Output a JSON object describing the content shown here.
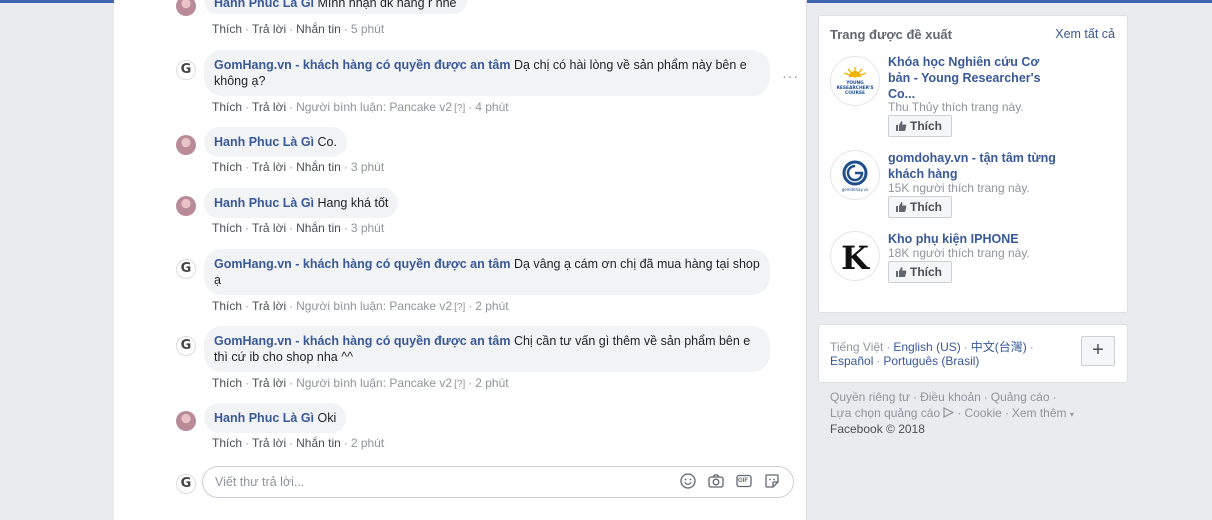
{
  "comments": [
    {
      "author": "Hanh Phuc Là Gì",
      "text": "Mình nhận đk hàng r nhé",
      "actions": [
        "Thích",
        "Trả lời",
        "Nhắn tin"
      ],
      "time": "5 phút",
      "avatar": "photo"
    },
    {
      "author": "GomHang.vn - khách hàng có quyền được an tâm",
      "text": "Dạ chị có hài lòng về sản phẩm này bên e không ạ?",
      "actions": [
        "Thích",
        "Trả lời"
      ],
      "plugin": "Người bình luận: Pancake v2",
      "help": "[?]",
      "time": "4 phút",
      "avatar": "G"
    },
    {
      "author": "Hanh Phuc Là Gì",
      "text": "Co.",
      "actions": [
        "Thích",
        "Trả lời",
        "Nhắn tin"
      ],
      "time": "3 phút",
      "avatar": "photo"
    },
    {
      "author": "Hanh Phuc Là Gì",
      "text": "Hang khá tốt",
      "actions": [
        "Thích",
        "Trả lời",
        "Nhắn tin"
      ],
      "time": "3 phút",
      "avatar": "photo"
    },
    {
      "author": "GomHang.vn - khách hàng có quyền được an tâm",
      "text": "Dạ vâng ạ cám ơn chị đã mua hàng tại shop ạ",
      "actions": [
        "Thích",
        "Trả lời"
      ],
      "plugin": "Người bình luận: Pancake v2",
      "help": "[?]",
      "time": "2 phút",
      "avatar": "G"
    },
    {
      "author": "GomHang.vn - khách hàng có quyền được an tâm",
      "text": "Chị cần tư vấn gì thêm về sản phẩm bên e thì cứ ib cho shop nha ^^",
      "actions": [
        "Thích",
        "Trả lời"
      ],
      "plugin": "Người bình luận: Pancake v2",
      "help": "[?]",
      "time": "2 phút",
      "avatar": "G"
    },
    {
      "author": "Hanh Phuc Là Gì",
      "text": "Oki",
      "actions": [
        "Thích",
        "Trả lời",
        "Nhắn tin"
      ],
      "time": "2 phút",
      "avatar": "photo"
    }
  ],
  "reply": {
    "placeholder": "Viết thư trả lời...",
    "icons": [
      "emoji-icon",
      "camera-icon",
      "gif-icon",
      "sticker-icon"
    ],
    "gif_label": "GIF"
  },
  "more_label": "···",
  "suggested": {
    "title": "Trang được đề xuất",
    "see_all": "Xem tất cả",
    "like_label": "Thích",
    "pages": [
      {
        "name": "Khóa học Nghiên cứu Cơ bản - Young Researcher's Co...",
        "sub": "Thu Thủy thích trang này.",
        "logo": "YOUNG RESEARCHER'S COURSE"
      },
      {
        "name": "gomdohay.vn - tận tâm từng khách hàng",
        "sub": "15K người thích trang này.",
        "logo": "gomdohay.vn"
      },
      {
        "name": "Kho phụ kiện IPHONE",
        "sub": "18K người thích trang này.",
        "logo": "K"
      }
    ]
  },
  "languages": {
    "line1": [
      "Tiếng Việt",
      "English (US)",
      "中文(台灣)"
    ],
    "line2": [
      "Español",
      "Português (Brasil)"
    ],
    "plus": "+"
  },
  "footer": {
    "line1": [
      "Quyền riêng tư",
      "Điều khoản",
      "Quảng cáo"
    ],
    "line2": [
      "Lựa chọn quảng cáo",
      "Cookie",
      "Xem thêm"
    ],
    "copyright": "Facebook © 2018"
  },
  "colors": {
    "link": "#385898",
    "bubble": "#f2f3f5",
    "bg": "#e9ebee",
    "accent": "#4267b2"
  }
}
